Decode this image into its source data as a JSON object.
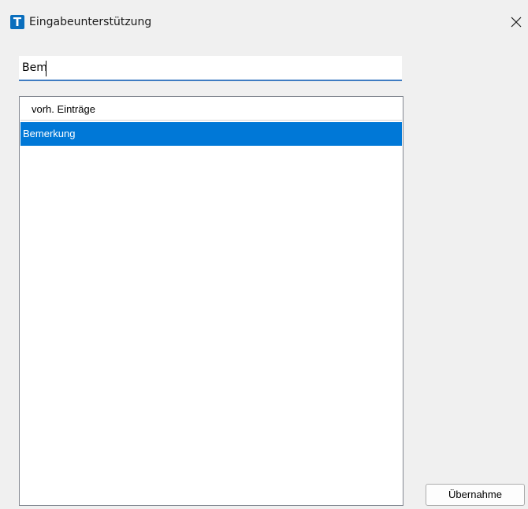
{
  "window": {
    "title": "Eingabeunterstützung",
    "icon": "T",
    "close_icon": "close-icon"
  },
  "search": {
    "value": "Bem"
  },
  "list": {
    "header": "vorh. Einträge",
    "items": [
      {
        "label": "Bemerkung",
        "selected": true
      }
    ]
  },
  "actions": {
    "apply_label": "Übernahme"
  },
  "colors": {
    "accent": "#0078d7",
    "app_icon": "#0a6ebd",
    "input_underline": "#3f7cc2",
    "background": "#f0f0f0"
  }
}
